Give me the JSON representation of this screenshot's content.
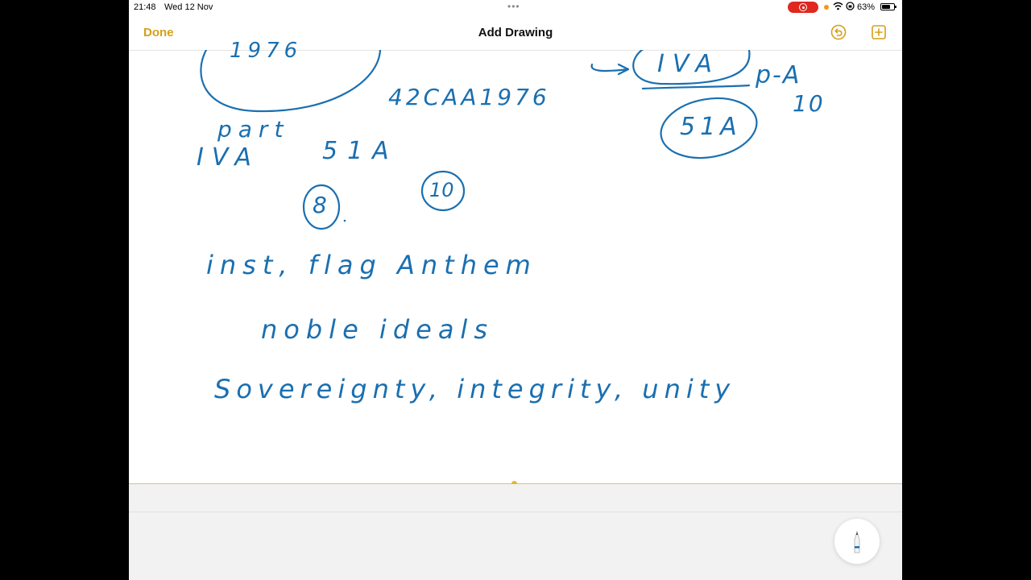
{
  "status_bar": {
    "time": "21:48",
    "date": "Wed 12 Nov",
    "multitask_dots": "•••",
    "battery": "63%"
  },
  "nav": {
    "done_label": "Done",
    "title": "Add Drawing",
    "undo_icon": "undo-icon",
    "add_icon": "plus-square-icon"
  },
  "drawing": {
    "ink_color": "#1a6fb0",
    "accent_color": "#d4a017",
    "notes": {
      "top_circle": "1976",
      "law_ref": "42CAA1976",
      "part": "part",
      "iva": "IVA",
      "sec_51a": "51A",
      "num_8": "8",
      "num_10": "10",
      "right_iva": "IVA",
      "right_pa": "p-A",
      "right_10": "10",
      "right_51a": "51A",
      "line_inst": "inst, flag Anthem",
      "line_noble": "noble ideals",
      "line_sovereignty": "Sovereignty, integrity, unity"
    }
  }
}
